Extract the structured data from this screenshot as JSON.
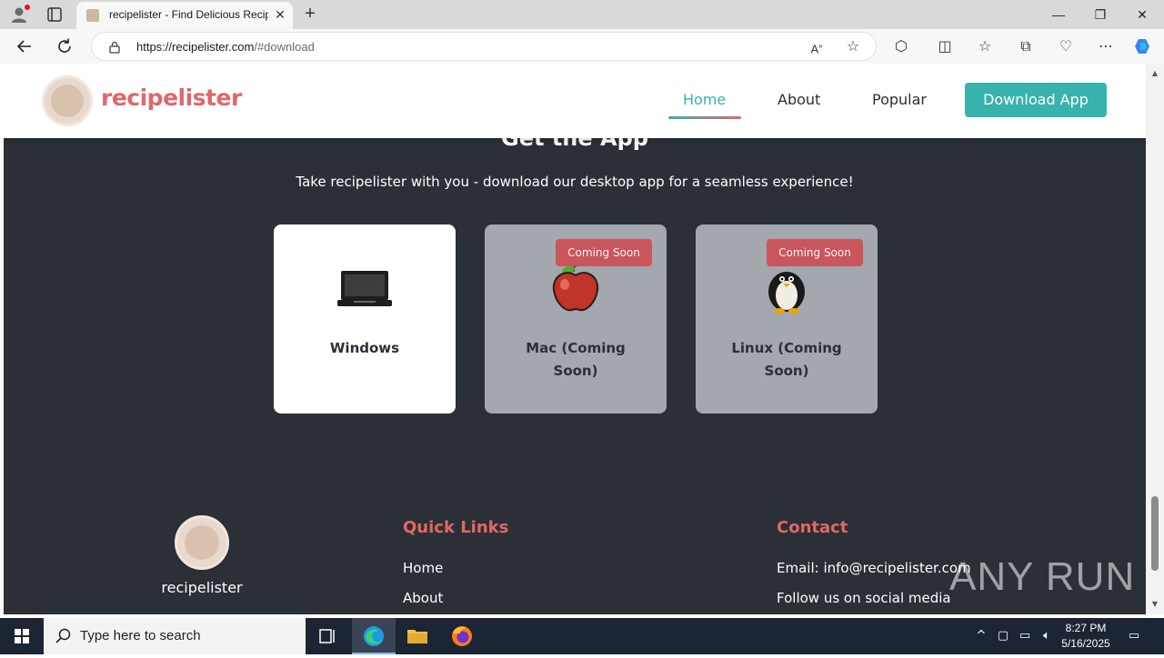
{
  "browser": {
    "tab_title": "recipelister - Find Delicious Recipes",
    "url_host": "https://recipelister.com",
    "url_path": "/#download"
  },
  "header": {
    "brand": "recipelister",
    "nav": [
      "Home",
      "About",
      "Popular"
    ],
    "active_nav": "Home",
    "cta": "Download App"
  },
  "download": {
    "title": "Get the App",
    "subtitle": "Take recipelister with you - download our desktop app for a seamless experience!",
    "cards": [
      {
        "label": "Windows",
        "icon": "laptop-icon",
        "badge": "",
        "disabled": false
      },
      {
        "label": "Mac (Coming Soon)",
        "icon": "apple-icon",
        "badge": "Coming Soon",
        "disabled": true
      },
      {
        "label": "Linux (Coming Soon)",
        "icon": "penguin-icon",
        "badge": "Coming Soon",
        "disabled": true
      }
    ]
  },
  "footer": {
    "brand": "recipelister",
    "quick_links_title": "Quick Links",
    "quick_links": [
      "Home",
      "About"
    ],
    "contact_title": "Contact",
    "email": "Email: info@recipelister.com",
    "social": "Follow us on social media"
  },
  "watermark": "ANY RUN",
  "taskbar": {
    "search_placeholder": "Type here to search",
    "time": "8:27 PM",
    "date": "5/16/2025"
  },
  "colors": {
    "brand_coral": "#e0676a",
    "brand_teal": "#38b2ac",
    "section_bg": "#2b2f36",
    "badge_red": "#c8565a"
  }
}
